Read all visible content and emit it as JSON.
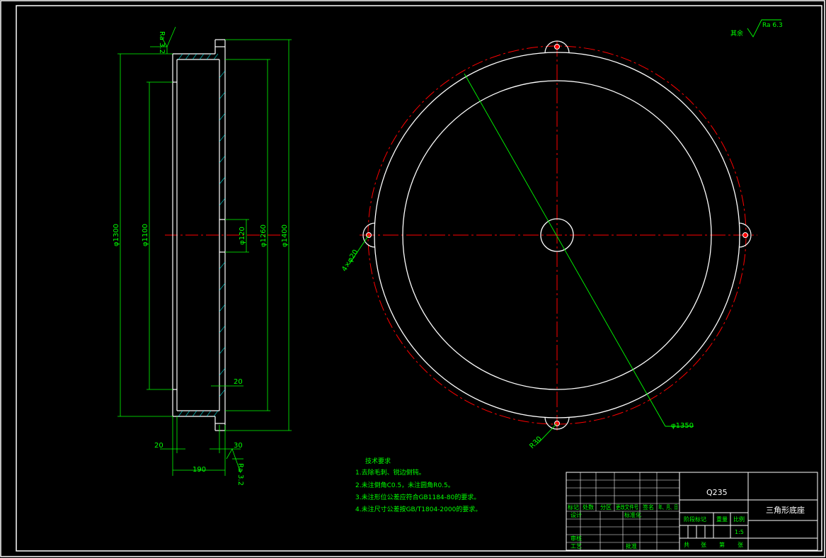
{
  "colors": {
    "background": "#000000",
    "outline": "#ffffff",
    "centerline": "#ff0000",
    "dimension": "#00ff00",
    "hatch": "#00ffff",
    "hole_fill": "#ff0000"
  },
  "roughness": {
    "top_side": "Ra 3.2",
    "bottom_side": "Ra 3.2",
    "general_prefix": "其余",
    "general_value": "Ra 6.3"
  },
  "section_view": {
    "dims": {
      "d1300": "φ1300",
      "d1100": "φ1100",
      "d120": "φ120",
      "d1260": "φ1260",
      "d1400": "φ1400",
      "w20_left": "20",
      "w30_right": "30",
      "w190": "190",
      "w20_inner": "20"
    }
  },
  "plan_view": {
    "dims": {
      "d1350": "φ1350",
      "holes": "4×φ20",
      "r30": "R30"
    }
  },
  "notes": {
    "title": "技术要求",
    "items": [
      "1.去除毛刺、锐边倒钝。",
      "2.未注倒角C0.5，未注圆角R0.5。",
      "3.未注形位公差应符合GB1184-80的要求。",
      "4.未注尺寸公差按GB/T1804-2000的要求。"
    ]
  },
  "title_block": {
    "material": "Q235",
    "part_name": "三角形底座",
    "scale": "1:5",
    "labels": {
      "mark": "标记",
      "count": "处数",
      "zone": "分区",
      "change_doc": "更改文件号",
      "sign": "签名",
      "date": "年、月、日",
      "design": "设计",
      "standardize": "标准化",
      "review": "审核",
      "process": "工艺",
      "approve": "批准",
      "stage_mark": "阶段标记",
      "weight": "重量",
      "scale_label": "比例",
      "total": "共",
      "sheets": "张",
      "page": "第",
      "sheet": "张"
    }
  }
}
